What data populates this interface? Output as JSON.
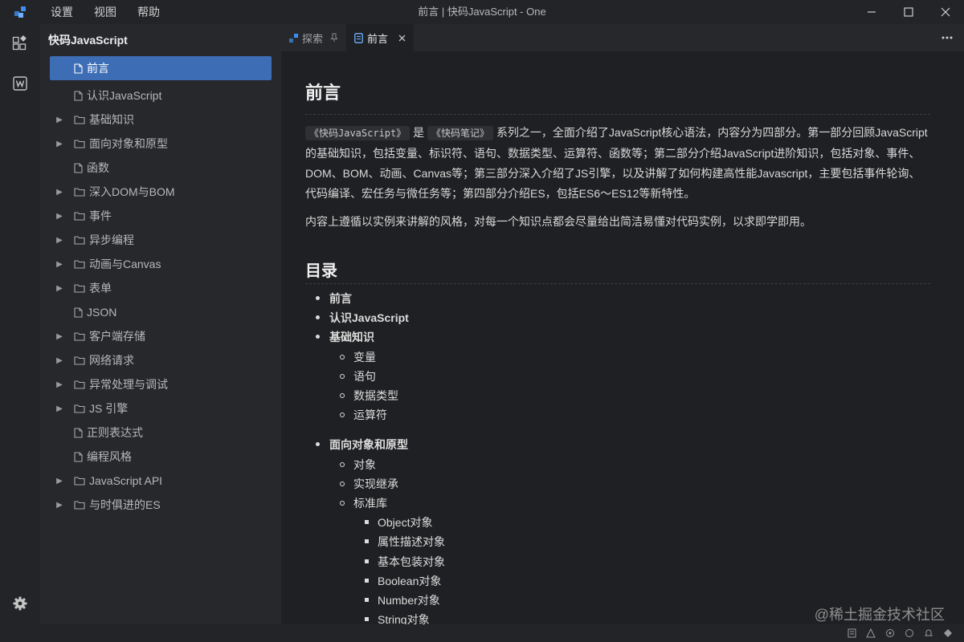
{
  "app": {
    "menu": [
      "设置",
      "视图",
      "帮助"
    ],
    "window_title": "前言 | 快码JavaScript - One"
  },
  "sidebar": {
    "title": "快码JavaScript",
    "items": [
      {
        "label": "前言",
        "type": "file",
        "active": true
      },
      {
        "label": "认识JavaScript",
        "type": "file"
      },
      {
        "label": "基础知识",
        "type": "folder"
      },
      {
        "label": "面向对象和原型",
        "type": "folder"
      },
      {
        "label": "函数",
        "type": "file"
      },
      {
        "label": "深入DOM与BOM",
        "type": "folder"
      },
      {
        "label": "事件",
        "type": "folder"
      },
      {
        "label": "异步编程",
        "type": "folder"
      },
      {
        "label": "动画与Canvas",
        "type": "folder"
      },
      {
        "label": "表单",
        "type": "folder"
      },
      {
        "label": "JSON",
        "type": "file"
      },
      {
        "label": "客户端存储",
        "type": "folder"
      },
      {
        "label": "网络请求",
        "type": "folder"
      },
      {
        "label": "异常处理与调试",
        "type": "folder"
      },
      {
        "label": "JS 引擎",
        "type": "folder"
      },
      {
        "label": "正则表达式",
        "type": "file"
      },
      {
        "label": "编程风格",
        "type": "file"
      },
      {
        "label": "JavaScript API",
        "type": "folder"
      },
      {
        "label": "与时俱进的ES",
        "type": "folder"
      }
    ]
  },
  "tabs": [
    {
      "label": "探索",
      "icon": "explore-icon",
      "pin": true,
      "active": false
    },
    {
      "label": "前言",
      "icon": "doc-icon",
      "active": true
    }
  ],
  "editor": {
    "h1": "前言",
    "intro": {
      "code1": "《快码JavaScript》",
      "is": "是",
      "code2": "《快码笔记》",
      "rest": "系列之一，全面介绍了JavaScript核心语法，内容分为四部分。第一部分回顾JavaScript的基础知识，包括变量、标识符、语句、数据类型、运算符、函数等；第二部分介绍JavaScript进阶知识，包括对象、事件、DOM、BOM、动画、Canvas等；第三部分深入介绍了JS引擎，以及讲解了如何构建高性能Javascript，主要包括事件轮询、代码编译、宏任务与微任务等；第四部分介绍ES，包括ES6～ES12等新特性。"
    },
    "para2": "内容上遵循以实例来讲解的风格，对每一个知识点都会尽量给出简洁易懂对代码实例，以求即学即用。",
    "h2": "目录",
    "toc": [
      {
        "label": "前言",
        "level": 1
      },
      {
        "label": "认识JavaScript",
        "level": 1
      },
      {
        "label": "基础知识",
        "level": 1
      },
      {
        "label": "变量",
        "level": 2
      },
      {
        "label": "语句",
        "level": 2
      },
      {
        "label": "数据类型",
        "level": 2
      },
      {
        "label": "运算符",
        "level": 2
      },
      {
        "gap": true
      },
      {
        "label": "面向对象和原型",
        "level": 1
      },
      {
        "label": "对象",
        "level": 2
      },
      {
        "label": "实现继承",
        "level": 2
      },
      {
        "label": "标准库",
        "level": 2
      },
      {
        "label": "Object对象",
        "level": 3
      },
      {
        "label": "属性描述对象",
        "level": 3
      },
      {
        "label": "基本包装对象",
        "level": 3
      },
      {
        "label": "Boolean对象",
        "level": 3
      },
      {
        "label": "Number对象",
        "level": 3
      },
      {
        "label": "String对象",
        "level": 3
      }
    ]
  },
  "watermark": "@稀土掘金技术社区",
  "colors": {
    "accent": "#3d6db5",
    "editor_bg": "#1f2023",
    "sidebar_bg": "#26282c"
  }
}
